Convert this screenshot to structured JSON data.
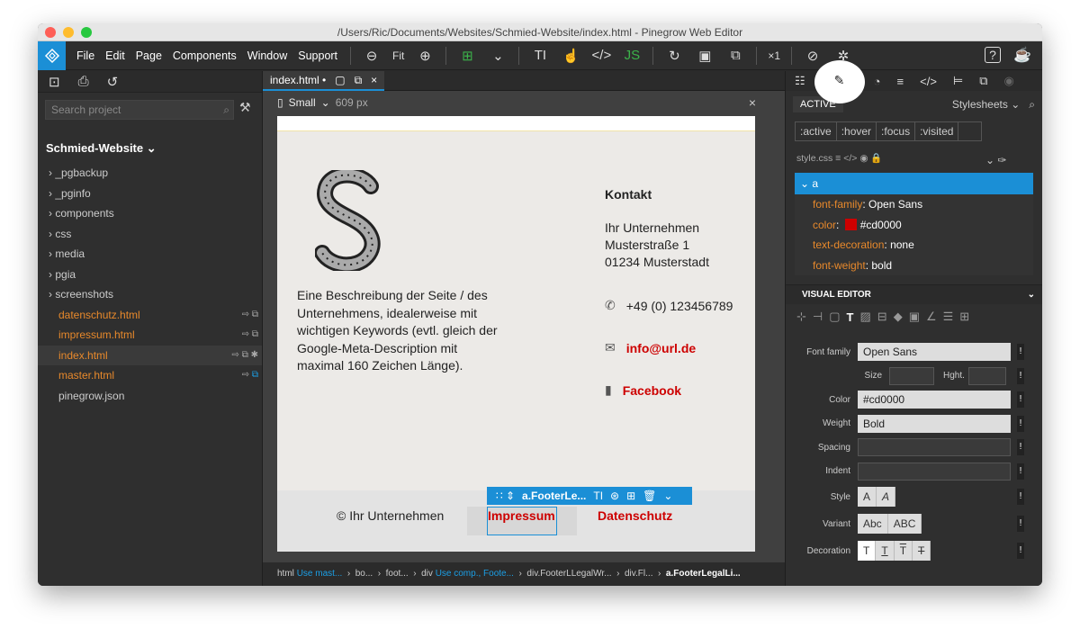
{
  "window": {
    "title": "/Users/Ric/Documents/Websites/Schmied-Website/index.html - Pinegrow Web Editor"
  },
  "menu": [
    "File",
    "Edit",
    "Page",
    "Components",
    "Window",
    "Support"
  ],
  "toolbar": {
    "fit_label": "Fit",
    "multiplier": "×1"
  },
  "left": {
    "search_placeholder": "Search project",
    "project_name": "Schmied-Website",
    "folders": [
      "_pgbackup",
      "_pginfo",
      "components",
      "css",
      "media",
      "pgia",
      "screenshots"
    ],
    "files": [
      {
        "name": "datenschutz.html",
        "type": "orange"
      },
      {
        "name": "impressum.html",
        "type": "orange"
      },
      {
        "name": "index.html",
        "type": "orange"
      },
      {
        "name": "master.html",
        "type": "orange"
      },
      {
        "name": "pinegrow.json",
        "type": "plain"
      }
    ]
  },
  "center": {
    "tab": "index.html •",
    "device": "Small",
    "width": "609 px",
    "page": {
      "description": "Eine Beschreibung der Seite / des Unternehmens, idealerweise mit wichtigen Keywords (evtl. gleich der Google-Meta-Description mit maximal 160 Zeichen Länge).",
      "contact_title": "Kontakt",
      "company": "Ihr Unternehmen",
      "street": "Musterstraße 1",
      "city": "01234 Musterstadt",
      "phone": "+49 (0) 123456789",
      "email": "info@url.de",
      "facebook": "Facebook",
      "copyright": "© Ihr Unternehmen",
      "impressum": "Impressum",
      "datenschutz": "Datenschutz"
    },
    "selected_element": "a.FooterLe...",
    "breadcrumb": [
      {
        "t": "html",
        "b": "Use mast..."
      },
      {
        "t": "bo...",
        "b": ""
      },
      {
        "t": "foot...",
        "b": ""
      },
      {
        "t": "div",
        "b": "Use comp., Foote..."
      },
      {
        "t": "div.FooterLLegalWr...",
        "b": ""
      },
      {
        "t": "div.Fl...",
        "b": ""
      },
      {
        "t": "a.FooterLegalLi...",
        "b": ""
      }
    ]
  },
  "right": {
    "active_tab": "ACTIVE",
    "stylesheets": "Stylesheets",
    "pseudos": [
      ":active",
      ":hover",
      ":focus",
      ":visited"
    ],
    "stylesheet_name": "style.css",
    "rule_selector": "a",
    "props": [
      {
        "k": "font-family",
        "v": "Open Sans"
      },
      {
        "k": "color",
        "v": "#cd0000"
      },
      {
        "k": "text-decoration",
        "v": "none"
      },
      {
        "k": "font-weight",
        "v": "bold"
      }
    ],
    "visual_editor": "VISUAL EDITOR",
    "ve": {
      "font_family_label": "Font family",
      "font_family": "Open Sans",
      "size_label": "Size",
      "height_label": "Hght.",
      "color_label": "Color",
      "color": "#cd0000",
      "weight_label": "Weight",
      "weight": "Bold",
      "spacing_label": "Spacing",
      "indent_label": "Indent",
      "style_label": "Style",
      "variant_label": "Variant",
      "decoration_label": "Decoration",
      "style_options": [
        "A",
        "A"
      ],
      "variant_options": [
        "Abc",
        "ABC"
      ],
      "decoration_options": [
        "T",
        "T",
        "T",
        "T"
      ]
    }
  },
  "colors": {
    "accent": "#1b8fd6",
    "link": "#cd0000",
    "orange": "#e8892b"
  }
}
